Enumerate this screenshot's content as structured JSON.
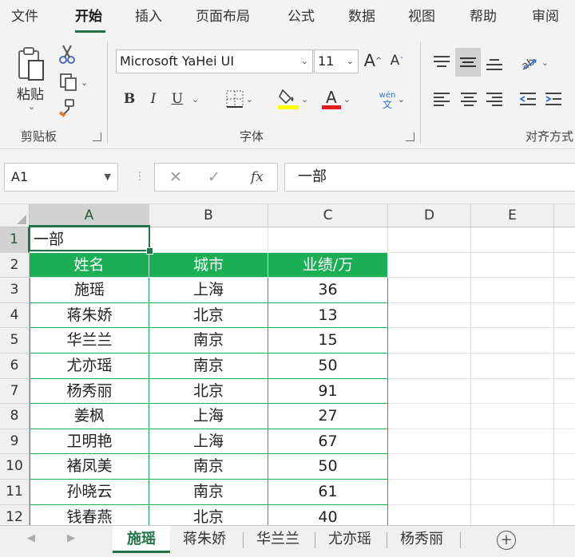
{
  "ribbon": {
    "tabs": [
      "文件",
      "开始",
      "插入",
      "页面布局",
      "公式",
      "数据",
      "视图",
      "帮助",
      "审阅"
    ],
    "active_tab": "开始",
    "clipboard": {
      "paste_label": "粘贴",
      "group_label": "剪贴板"
    },
    "font": {
      "font_name": "Microsoft YaHei UI",
      "font_size": "11",
      "group_label": "字体",
      "bold": "B",
      "italic": "I",
      "underline": "U",
      "wen": "wén",
      "wen_char": "文",
      "grow_font": "A",
      "shrink_font": "A",
      "font_color": "A"
    },
    "alignment": {
      "group_label": "对齐方式"
    }
  },
  "formula_bar": {
    "name_box": "A1",
    "cancel": "✕",
    "enter": "✓",
    "fx": "fx",
    "content": "一部"
  },
  "grid": {
    "columns": [
      "A",
      "B",
      "C",
      "D",
      "E"
    ],
    "rows": [
      "1",
      "2",
      "3",
      "4",
      "5",
      "6",
      "7",
      "8",
      "9",
      "10",
      "11",
      "12"
    ],
    "a1": "一部",
    "headers": [
      "姓名",
      "城市",
      "业绩/万"
    ],
    "records": [
      [
        "施瑶",
        "上海",
        "36"
      ],
      [
        "蒋朱娇",
        "北京",
        "13"
      ],
      [
        "华兰兰",
        "南京",
        "15"
      ],
      [
        "尤亦瑶",
        "南京",
        "50"
      ],
      [
        "杨秀丽",
        "北京",
        "91"
      ],
      [
        "姜枫",
        "上海",
        "27"
      ],
      [
        "卫明艳",
        "上海",
        "67"
      ],
      [
        "褚凤美",
        "南京",
        "50"
      ],
      [
        "孙晓云",
        "南京",
        "61"
      ],
      [
        "钱春燕",
        "北京",
        "40"
      ]
    ]
  },
  "sheets": {
    "tabs": [
      "施瑶",
      "蒋朱娇",
      "华兰兰",
      "尤亦瑶",
      "杨秀丽"
    ],
    "active": "施瑶",
    "add": "+"
  },
  "colors": {
    "accent": "#217346",
    "header_fill": "#1aaf54"
  }
}
